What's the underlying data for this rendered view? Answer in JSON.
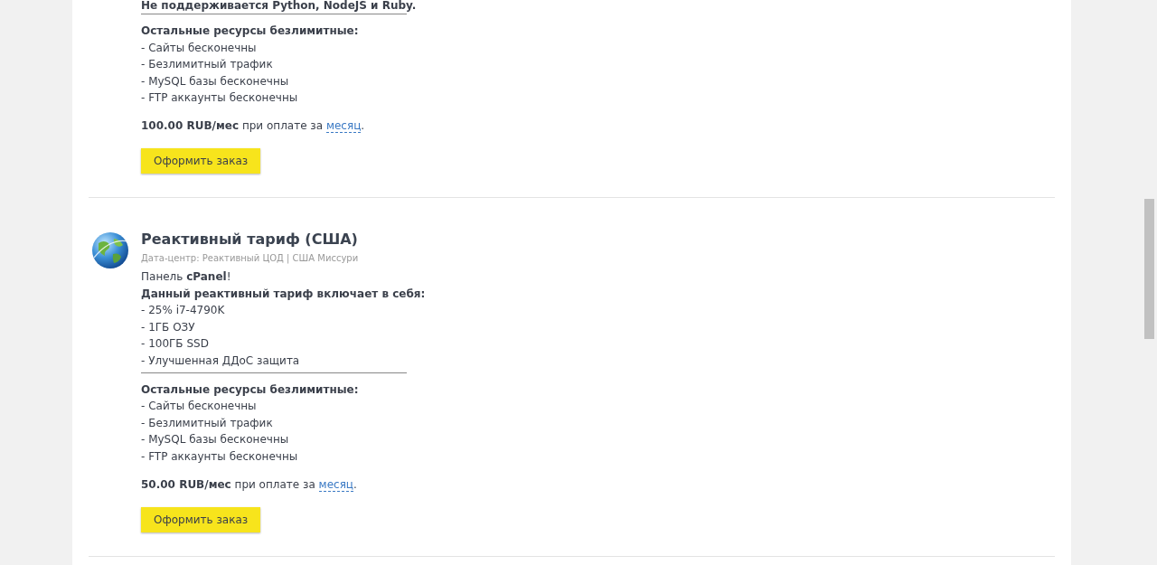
{
  "plans": [
    {
      "cut_note": "Не поддерживается Python, NodeJS и Ruby.",
      "resources_heading": "Остальные ресурсы безлимитные:",
      "resources": [
        "- Сайты бесконечны",
        "- Безлимитный трафик",
        "- MySQL базы бесконечны",
        "- FTP аккаунты бесконечны"
      ],
      "price": "100.00 RUB/мес",
      "price_text": "при оплате за",
      "period": "месяц",
      "period_end": ".",
      "button": "Оформить заказ"
    },
    {
      "title": "Реактивный тариф (США)",
      "datacenter": "Дата-центр: Реактивный ЦОД | США Миссури",
      "panel_note": "Панель **cPanel**!",
      "includes_heading": "Данный реактивный тариф включает в себя:",
      "includes": [
        "- 25% i7-4790K",
        "- 1ГБ ОЗУ",
        "- 100ГБ SSD",
        "- Улучшенная ДДоС защита"
      ],
      "resources_heading": "Остальные ресурсы безлимитные:",
      "resources": [
        "- Сайты бесконечны",
        "- Безлимитный трафик",
        "- MySQL базы бесконечны",
        "- FTP аккаунты бесконечны"
      ],
      "price": "50.00 RUB/мес",
      "price_text": "при оплате за",
      "period": "месяц",
      "period_end": ".",
      "button": "Оформить заказ"
    }
  ]
}
